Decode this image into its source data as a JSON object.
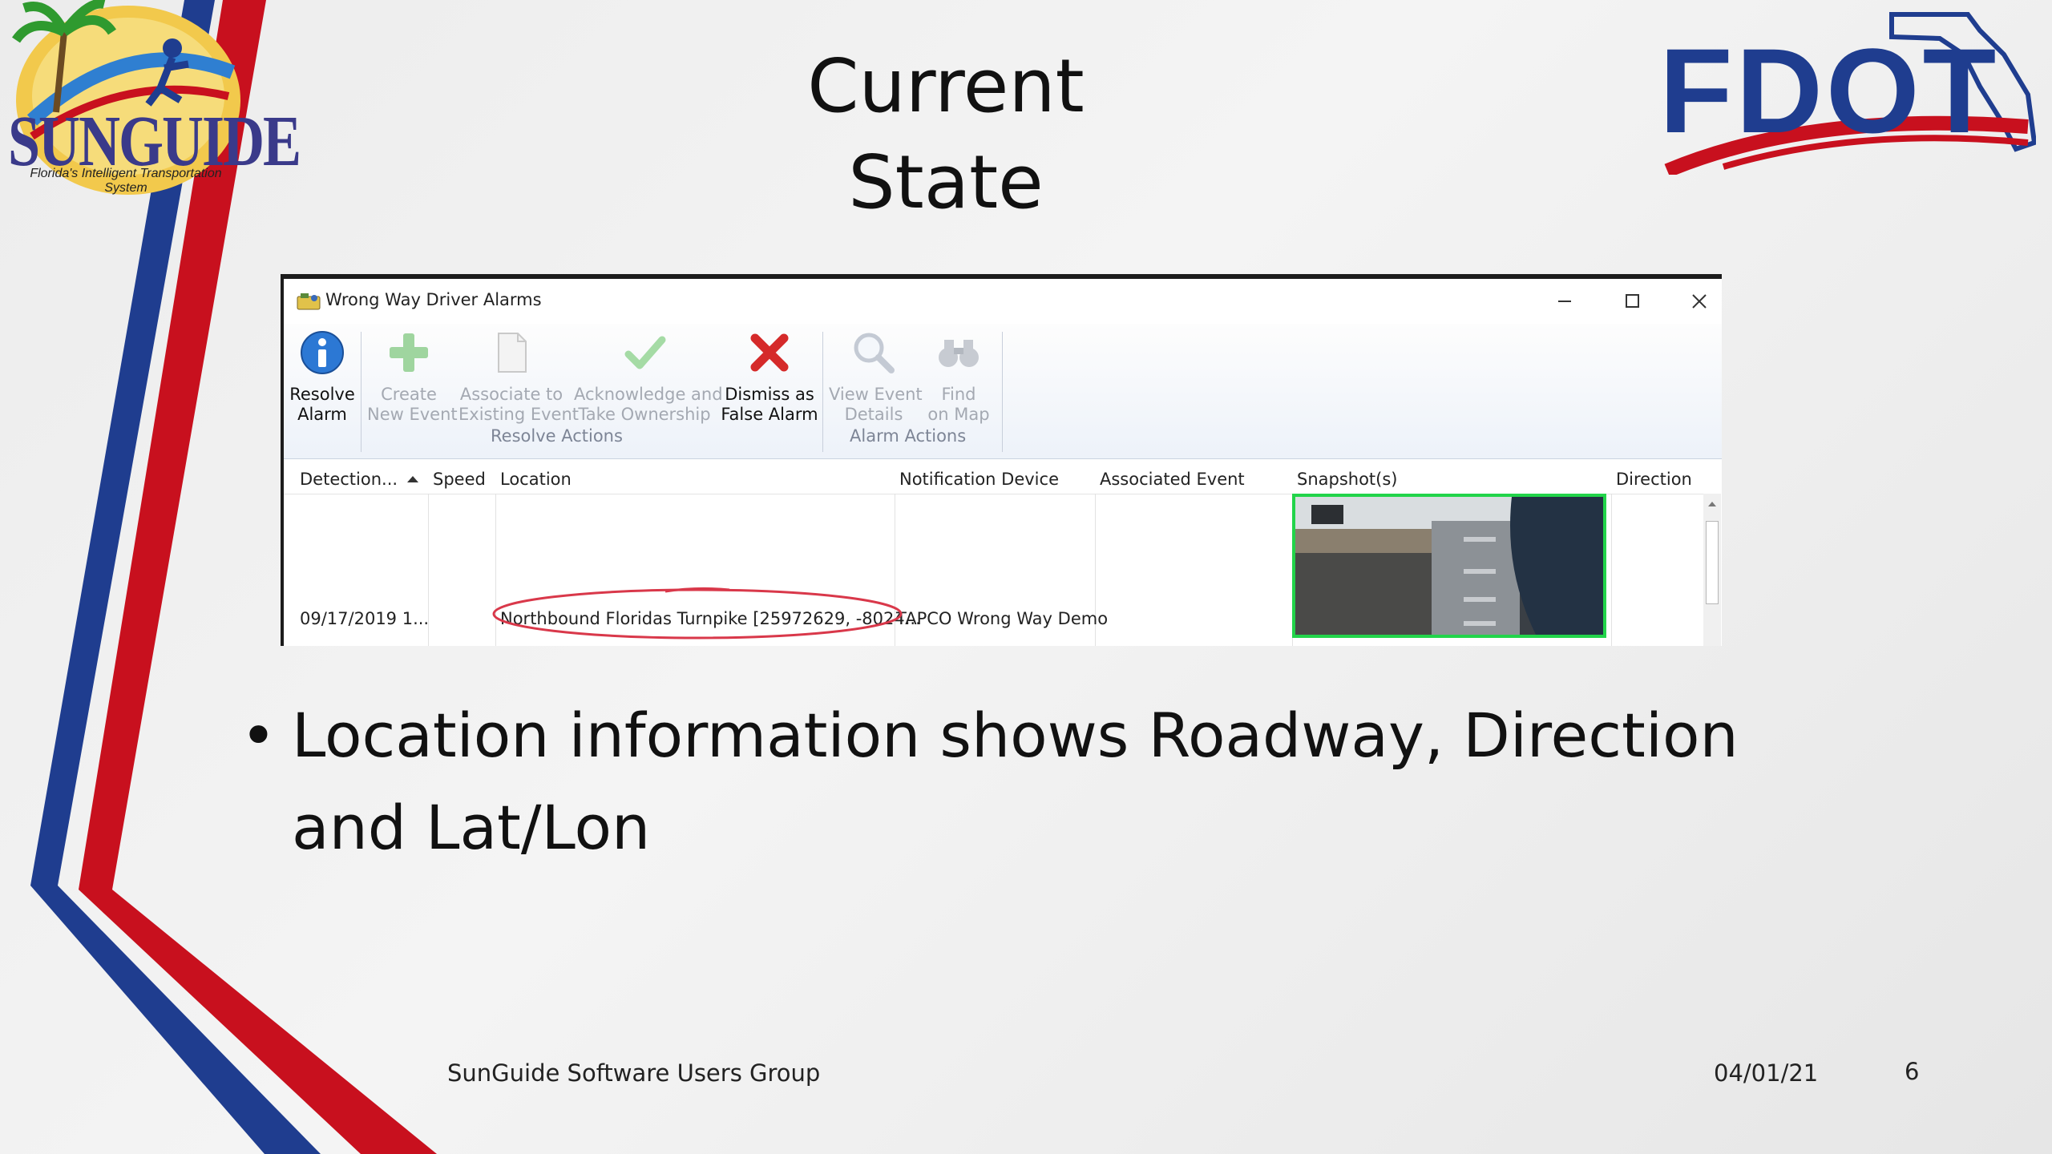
{
  "slide": {
    "title": "Current State",
    "bullet": "Location information shows Roadway, Direction and Lat/Lon",
    "footer_left": "SunGuide Software Users Group",
    "footer_date": "04/01/21",
    "page_number": "6"
  },
  "logos": {
    "sunguide_word": "SUNGUIDE",
    "sunguide_tagline": "Florida's Intelligent Transportation System",
    "fdot_word": "FDOT"
  },
  "window": {
    "title": "Wrong Way Driver Alarms",
    "minimize_icon": "minimize-icon",
    "maximize_icon": "maximize-icon",
    "close_icon": "close-icon"
  },
  "ribbon": {
    "resolve_alarm": {
      "line1": "Resolve",
      "line2": "Alarm",
      "icon": "info-icon"
    },
    "create_event": {
      "line1": "Create",
      "line2": "New Event",
      "icon": "plus-icon"
    },
    "associate": {
      "line1": "Associate to",
      "line2": "Existing Event",
      "icon": "document-icon"
    },
    "acknowledge": {
      "line1": "Acknowledge and",
      "line2": "Take Ownership",
      "icon": "checkmark-icon"
    },
    "dismiss": {
      "line1": "Dismiss as",
      "line2": "False Alarm",
      "icon": "red-x-icon"
    },
    "view_event": {
      "line1": "View Event",
      "line2": "Details",
      "icon": "magnifier-icon"
    },
    "find_map": {
      "line1": "Find",
      "line2": "on Map",
      "icon": "binoculars-icon"
    },
    "group_resolve": "Resolve Actions",
    "group_alarm": "Alarm Actions"
  },
  "grid": {
    "columns": [
      "Detection...",
      "Speed",
      "Location",
      "Notification Device",
      "Associated Event",
      "Snapshot(s)",
      "Direction"
    ],
    "rows": [
      {
        "detection": "09/17/2019 1...",
        "speed": "",
        "location": "Northbound Floridas Turnpike [25972629, -8024...",
        "device": "TAPCO Wrong Way Demo",
        "event": "",
        "direction": ""
      }
    ]
  },
  "colors": {
    "stripe_blue": "#1f3d8f",
    "stripe_red": "#c8101e",
    "snapshot_border": "#22d44a",
    "annotation_circle": "#d9384a"
  }
}
